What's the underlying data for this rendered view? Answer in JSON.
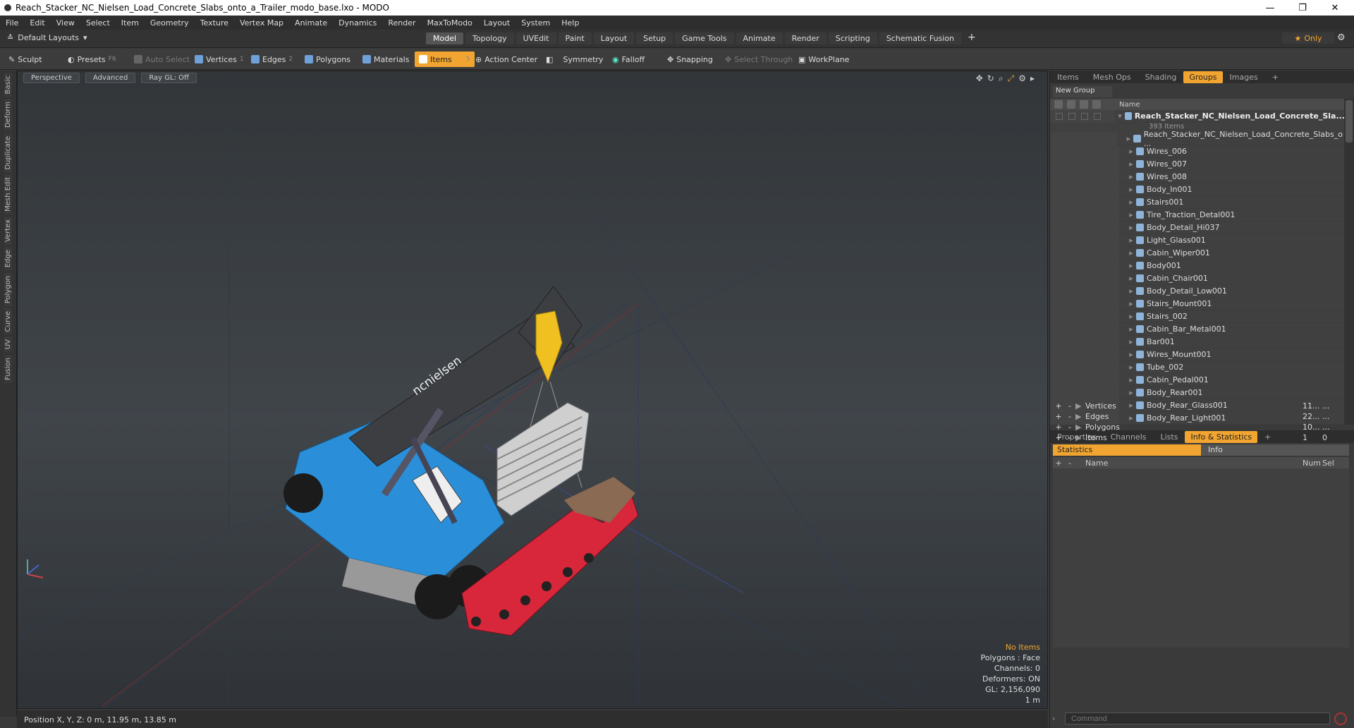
{
  "window": {
    "title": "Reach_Stacker_NC_Nielsen_Load_Concrete_Slabs_onto_a_Trailer_modo_base.lxo - MODO"
  },
  "menu": [
    "File",
    "Edit",
    "View",
    "Select",
    "Item",
    "Geometry",
    "Texture",
    "Vertex Map",
    "Animate",
    "Dynamics",
    "Render",
    "MaxToModo",
    "Layout",
    "System",
    "Help"
  ],
  "layouts": {
    "label": "Default Layouts"
  },
  "tabs": [
    "Model",
    "Topology",
    "UVEdit",
    "Paint",
    "Layout",
    "Setup",
    "Game Tools",
    "Animate",
    "Render",
    "Scripting",
    "Schematic Fusion"
  ],
  "only_label": "Only",
  "toolbar": {
    "sculpt": "Sculpt",
    "presets": "Presets",
    "presets_key": "F6",
    "auto_select": "Auto Select",
    "vertices": "Vertices",
    "vertices_n": "1",
    "edges": "Edges",
    "edges_n": "2",
    "polygons": "Polygons",
    "materials": "Materials",
    "items": "Items",
    "items_n": "5",
    "action_center": "Action Center",
    "symmetry": "Symmetry",
    "falloff": "Falloff",
    "snapping": "Snapping",
    "select_through": "Select Through",
    "workplane": "WorkPlane"
  },
  "left_tabs": [
    "Basic",
    "Deform",
    "Duplicate",
    "Mesh Edit",
    "Vertex",
    "Edge",
    "Polygon",
    "Curve",
    "UV",
    "Fusion"
  ],
  "viewport": {
    "perspective": "Perspective",
    "advanced": "Advanced",
    "raygl": "Ray GL: Off",
    "stats": {
      "no_items": "No Items",
      "polygons": "Polygons : Face",
      "channels": "Channels: 0",
      "deformers": "Deformers: ON",
      "gl": "GL: 2,156,090",
      "scale": "1 m"
    },
    "brand": "ncnielsen"
  },
  "status": {
    "position": "Position X, Y, Z:  0 m, 11.95 m, 13.85 m"
  },
  "panel_top": {
    "tabs": [
      "Items",
      "Mesh Ops",
      "Shading",
      "Groups",
      "Images"
    ],
    "active": "Groups",
    "new_group": "New Group",
    "col_name": "Name",
    "root": "Reach_Stacker_NC_Nielsen_Load_Concrete_Sla...",
    "root_count": "393 Items",
    "items": [
      "Reach_Stacker_NC_Nielsen_Load_Concrete_Slabs_o ...",
      "Wires_006",
      "Wires_007",
      "Wires_008",
      "Body_In001",
      "Stairs001",
      "Tire_Traction_Detal001",
      "Body_Detail_Hi037",
      "Light_Glass001",
      "Cabin_Wiper001",
      "Body001",
      "Cabin_Chair001",
      "Body_Detail_Low001",
      "Stairs_Mount001",
      "Stairs_002",
      "Cabin_Bar_Metal001",
      "Bar001",
      "Wires_Mount001",
      "Tube_002",
      "Cabin_Pedal001",
      "Body_Rear001",
      "Body_Rear_Glass001",
      "Body_Rear_Light001"
    ]
  },
  "panel_bottom": {
    "tabs": [
      "Properties",
      "Channels",
      "Lists",
      "Info & Statistics"
    ],
    "active": "Info & Statistics",
    "statistics": "Statistics",
    "info": "Info",
    "cols": {
      "name": "Name",
      "num": "Num",
      "sel": "Sel"
    },
    "rows": [
      {
        "name": "Vertices",
        "num": "11...",
        "sel": "..."
      },
      {
        "name": "Edges",
        "num": "22...",
        "sel": "..."
      },
      {
        "name": "Polygons",
        "num": "10...",
        "sel": "..."
      },
      {
        "name": "Items",
        "num": "1",
        "sel": "0"
      }
    ]
  },
  "command": {
    "placeholder": "Command"
  },
  "colors": {
    "accent": "#f1a530",
    "stacker_blue": "#2a8fd8",
    "trailer_red": "#d8263a",
    "hook": "#f0c020"
  }
}
